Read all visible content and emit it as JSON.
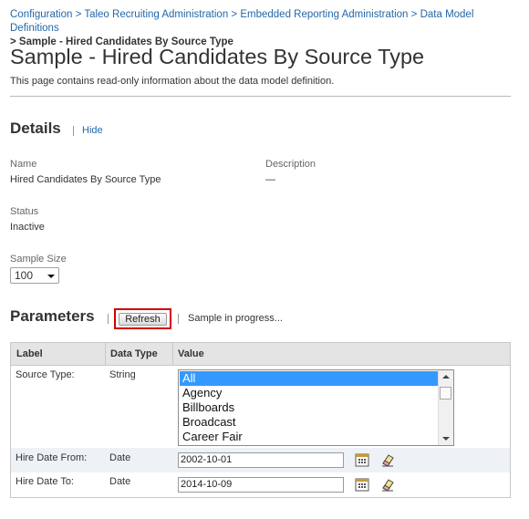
{
  "breadcrumb": {
    "items": [
      "Configuration",
      "Taleo Recruiting Administration",
      "Embedded Reporting Administration",
      "Data Model Definitions"
    ],
    "separator": ">",
    "current": "Sample - Hired Candidates By Source Type"
  },
  "page": {
    "title": "Sample - Hired Candidates By Source Type",
    "subtitle": "This page contains read-only information about the data model definition."
  },
  "details": {
    "heading": "Details",
    "hide_link": "Hide",
    "name_label": "Name",
    "name_value": "Hired Candidates By Source Type",
    "description_label": "Description",
    "description_value": "—",
    "status_label": "Status",
    "status_value": "Inactive",
    "sample_size_label": "Sample Size",
    "sample_size_value": "100"
  },
  "parameters": {
    "heading": "Parameters",
    "refresh_label": "Refresh",
    "status_text": "Sample in progress...",
    "columns": [
      "Label",
      "Data Type",
      "Value"
    ],
    "source_type": {
      "label": "Source Type:",
      "type": "String",
      "options": [
        "All",
        "Agency",
        "Billboards",
        "Broadcast",
        "Career Fair"
      ],
      "selected": "All"
    },
    "hire_date_from": {
      "label": "Hire Date From:",
      "type": "Date",
      "value": "2002-10-01"
    },
    "hire_date_to": {
      "label": "Hire Date To:",
      "type": "Date",
      "value": "2014-10-09"
    }
  },
  "colors": {
    "link": "#2467a8",
    "highlight_border": "#d40000",
    "selected_option": "#3399ff"
  }
}
